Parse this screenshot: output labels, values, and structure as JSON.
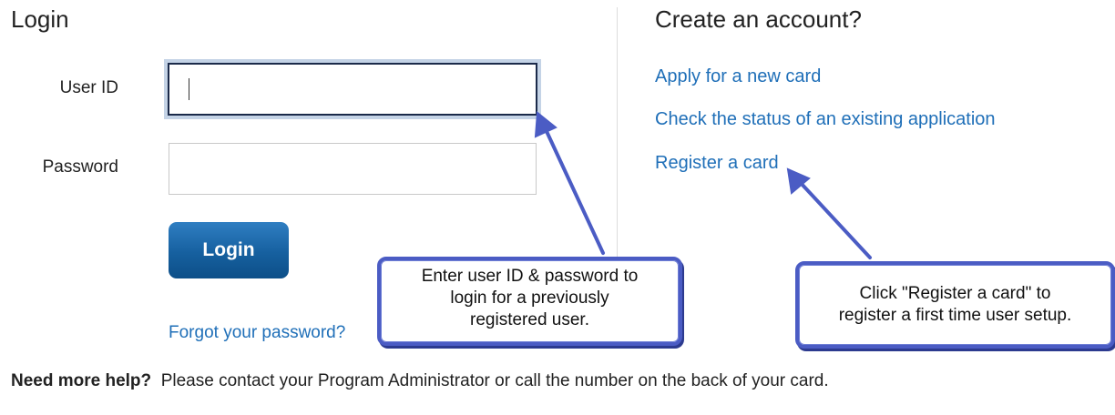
{
  "login": {
    "title": "Login",
    "user_id_label": "User ID",
    "user_id_value": "",
    "password_label": "Password",
    "password_value": "",
    "login_button": "Login",
    "forgot_link": "Forgot your password?"
  },
  "create_account": {
    "title": "Create an account?",
    "links": [
      "Apply for a new card",
      "Check the status of an existing application",
      "Register a card"
    ]
  },
  "callouts": {
    "left": [
      "Enter user ID & password to",
      "login for a previously",
      "registered user."
    ],
    "right": [
      "Click \"Register a card\" to",
      "register a first time user setup."
    ]
  },
  "help": {
    "bold": "Need more help?",
    "text": "Please contact your Program Administrator or call the number on the back of your card."
  },
  "colors": {
    "link": "#1f6fb8",
    "button": "#16609f",
    "callout_border": "#4b5cc4"
  }
}
